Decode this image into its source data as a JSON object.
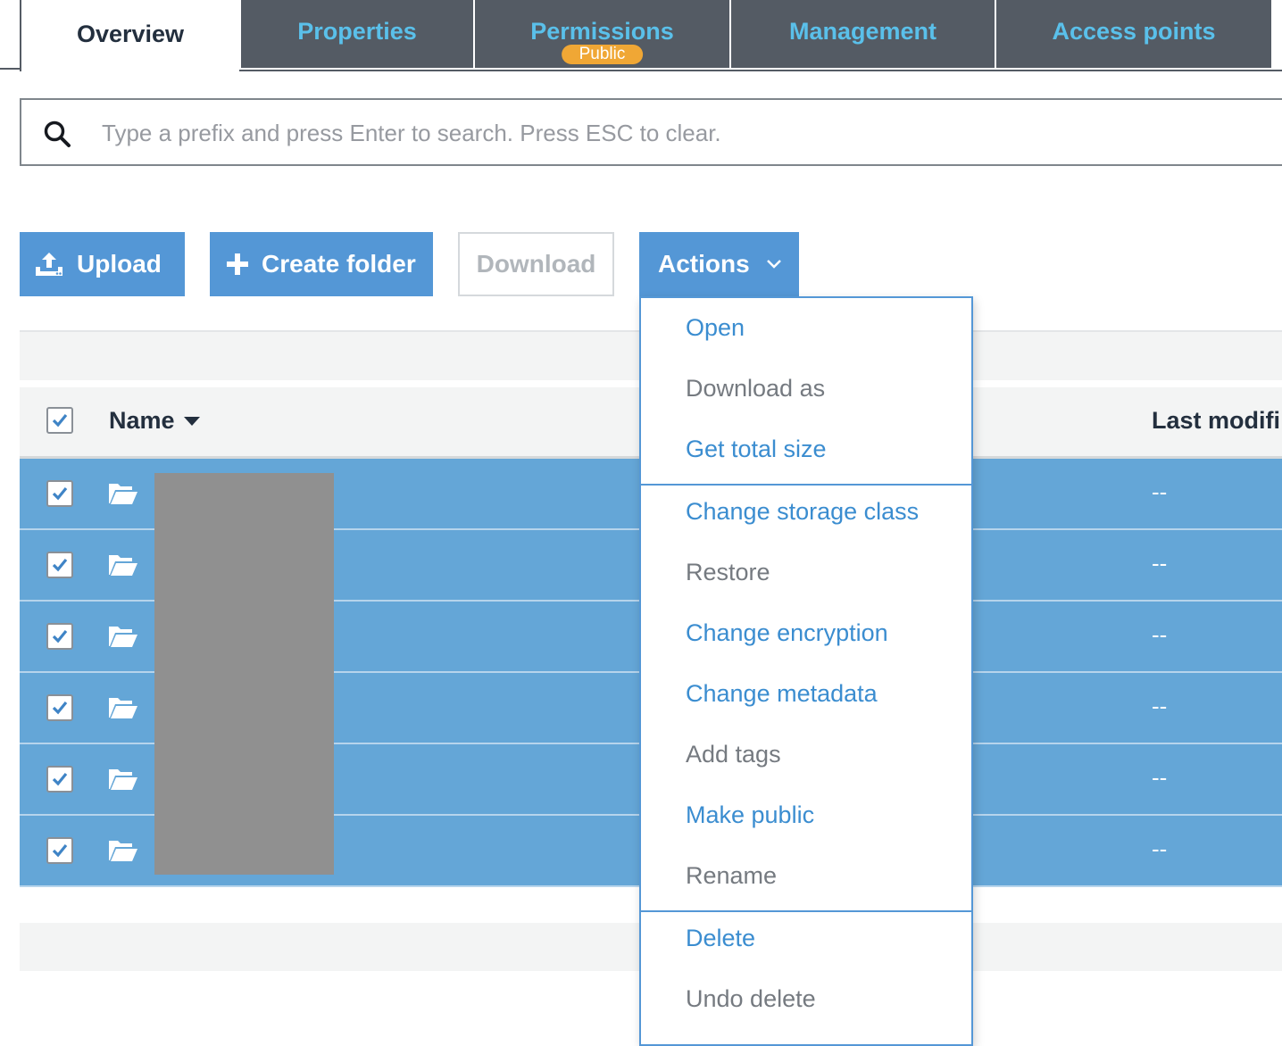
{
  "tabs": [
    {
      "label": "Overview"
    },
    {
      "label": "Properties"
    },
    {
      "label": "Permissions",
      "badge": "Public"
    },
    {
      "label": "Management"
    },
    {
      "label": "Access points"
    }
  ],
  "search": {
    "placeholder": "Type a prefix and press Enter to search. Press ESC to clear.",
    "value": "",
    "icon": "search-icon"
  },
  "toolbar": {
    "upload_label": "Upload",
    "create_folder_label": "Create folder",
    "download_label": "Download",
    "actions_label": "Actions"
  },
  "table": {
    "columns": {
      "name": "Name",
      "last_modified": "Last modifi"
    },
    "rows": [
      {
        "name": "",
        "last_modified": "--",
        "selected": true
      },
      {
        "name": "",
        "last_modified": "--",
        "selected": true
      },
      {
        "name": "",
        "last_modified": "--",
        "selected": true
      },
      {
        "name": "",
        "last_modified": "--",
        "selected": true
      },
      {
        "name": "",
        "last_modified": "--",
        "selected": true
      },
      {
        "name": "",
        "last_modified": "--",
        "selected": true
      }
    ]
  },
  "actions_menu": {
    "groups": [
      [
        {
          "label": "Open",
          "enabled": true
        },
        {
          "label": "Download as",
          "enabled": false
        },
        {
          "label": "Get total size",
          "enabled": true
        }
      ],
      [
        {
          "label": "Change storage class",
          "enabled": true
        },
        {
          "label": "Restore",
          "enabled": false
        },
        {
          "label": "Change encryption",
          "enabled": true
        },
        {
          "label": "Change metadata",
          "enabled": true
        },
        {
          "label": "Add tags",
          "enabled": false
        },
        {
          "label": "Make public",
          "enabled": true
        },
        {
          "label": "Rename",
          "enabled": false
        }
      ],
      [
        {
          "label": "Delete",
          "enabled": true
        },
        {
          "label": "Undo delete",
          "enabled": false
        }
      ]
    ]
  },
  "colors": {
    "tab_bg": "#545b64",
    "tab_text": "#5ac0ea",
    "primary": "#5497d6",
    "selected_row": "#64a6d7",
    "badge": "#f0a735"
  }
}
